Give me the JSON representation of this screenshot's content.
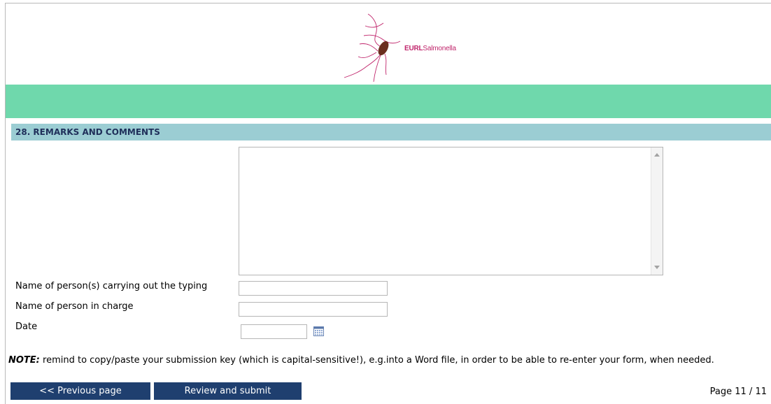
{
  "logo": {
    "brand_bold": "EURL",
    "brand_rest": "Salmonella"
  },
  "section": {
    "title": "28. REMARKS AND COMMENTS"
  },
  "remarks": {
    "value": ""
  },
  "fields": {
    "typing_label": "Name of person(s) carrying out the typing",
    "typing_value": "",
    "in_charge_label": "Name of person in charge",
    "in_charge_value": "",
    "date_label": "Date",
    "date_value": ""
  },
  "note": {
    "prefix": "NOTE:",
    "text": " remind to copy/paste your submission key (which is capital-sensitive!), e.g.into a Word file, in order to be able to re-enter your form, when needed."
  },
  "nav": {
    "previous_label": "<< Previous page",
    "review_label": "Review and submit",
    "page_indicator": "Page 11 / 11"
  },
  "colors": {
    "green_band": "#6fd8ac",
    "section_bar": "#9bcdd3",
    "button_bg": "#1f3f6f",
    "logo_pink": "#c0266c",
    "logo_brown": "#6b2e1e"
  },
  "icons": {
    "logo": "salmonella-bacterium-logo",
    "calendar": "calendar-icon",
    "scroll_up": "arrow-up-icon",
    "scroll_down": "arrow-down-icon"
  }
}
